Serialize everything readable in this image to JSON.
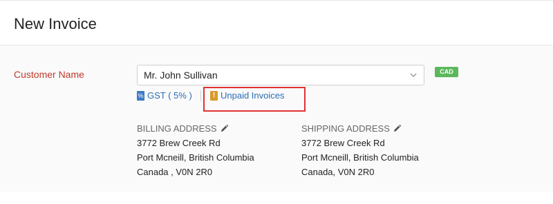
{
  "header": {
    "title": "New Invoice"
  },
  "customer": {
    "label": "Customer Name",
    "selected": "Mr. John Sullivan",
    "currency": "CAD",
    "tax_label": "GST ( 5% )",
    "tax_icon_glyph": "%",
    "unpaid_label": "Unpaid Invoices",
    "unpaid_icon_glyph": "!"
  },
  "billing": {
    "heading": "BILLING ADDRESS",
    "line1": "3772 Brew Creek Rd",
    "line2": "Port Mcneill, British Columbia",
    "line3": "Canada , V0N 2R0"
  },
  "shipping": {
    "heading": "SHIPPING ADDRESS",
    "line1": "3772 Brew Creek Rd",
    "line2": "Port Mcneill, British Columbia",
    "line3": "Canada, V0N 2R0"
  },
  "icons": {
    "chevron": "chevron-down-icon",
    "pencil": "pencil-icon",
    "tax": "tax-icon",
    "warning": "warning-icon"
  },
  "colors": {
    "required_label": "#c0392b",
    "link": "#2a6db5",
    "currency_badge": "#5cb85c",
    "highlight": "#e03131"
  }
}
